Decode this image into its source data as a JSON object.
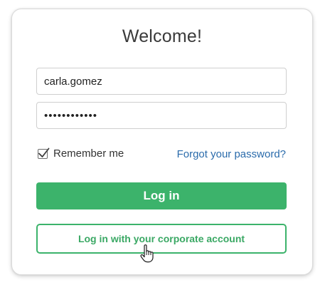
{
  "login_card": {
    "title": "Welcome!",
    "username": {
      "value": "carla.gomez",
      "placeholder": ""
    },
    "password": {
      "masked_value": "••••••••••••"
    },
    "remember_me": {
      "label": "Remember me",
      "checked": true
    },
    "forgot_password_link": "Forgot your password?",
    "login_button": "Log in",
    "corporate_login_button": "Log in with your corporate account"
  },
  "colors": {
    "accent_green": "#3cb36b",
    "link_blue": "#2a6bab",
    "title_text": "#3a3a3a"
  },
  "icons": {
    "checkbox": "checkmark-icon",
    "cursor": "hand-pointer-cursor-icon"
  }
}
